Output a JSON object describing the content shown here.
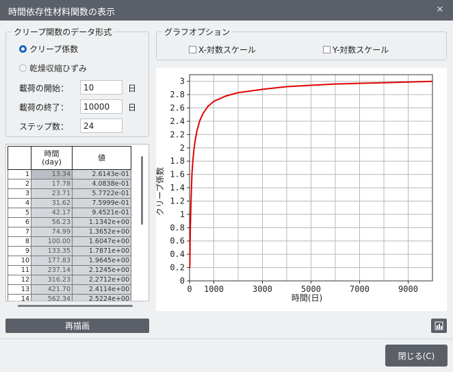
{
  "window": {
    "title": "時間依存性材料関数の表示",
    "close_glyph": "✕"
  },
  "data_format": {
    "group_label": "クリープ関数のデータ形式",
    "options": [
      {
        "label": "クリープ係数",
        "selected": true
      },
      {
        "label": "乾燥収縮ひずみ",
        "selected": false
      }
    ],
    "load_start_label": "載荷の開始：",
    "load_start_value": "10",
    "load_start_unit": "日",
    "load_end_label": "載荷の終了：",
    "load_end_value": "10000",
    "load_end_unit": "日",
    "steps_label": "ステップ数：",
    "steps_value": "24"
  },
  "graph_options": {
    "group_label": "グラフオプション",
    "x_log_label": "X-対数スケール",
    "x_log_checked": false,
    "y_log_label": "Y-対数スケール",
    "y_log_checked": false
  },
  "table": {
    "headers": [
      "",
      "時間\n(day)",
      "値"
    ],
    "rows": [
      [
        "1",
        "13.34",
        "2.6143e-01"
      ],
      [
        "2",
        "17.78",
        "4.0838e-01"
      ],
      [
        "3",
        "23.71",
        "5.7722e-01"
      ],
      [
        "4",
        "31.62",
        "7.5999e-01"
      ],
      [
        "5",
        "42.17",
        "9.4521e-01"
      ],
      [
        "6",
        "56.23",
        "1.1342e+00"
      ],
      [
        "7",
        "74.99",
        "1.3652e+00"
      ],
      [
        "8",
        "100.00",
        "1.6047e+00"
      ],
      [
        "9",
        "133.35",
        "1.7871e+00"
      ],
      [
        "10",
        "177.83",
        "1.9645e+00"
      ],
      [
        "11",
        "237.14",
        "2.1245e+00"
      ],
      [
        "12",
        "316.23",
        "2.2712e+00"
      ],
      [
        "13",
        "421.70",
        "2.4114e+00"
      ],
      [
        "14",
        "562.34",
        "2.5224e+00"
      ]
    ]
  },
  "buttons": {
    "redraw": "再描画",
    "close": "閉じる(C)",
    "chart_icon": "bar-chart-icon"
  },
  "chart_data": {
    "type": "line",
    "xlabel": "時間(日)",
    "ylabel": "クリープ係数",
    "xlim": [
      0,
      10000
    ],
    "ylim": [
      0,
      3.1
    ],
    "xticks": [
      0,
      1000,
      3000,
      5000,
      7000,
      9000
    ],
    "yticks": [
      0,
      0.2,
      0.4,
      0.6,
      0.8,
      1,
      1.2,
      1.4,
      1.6,
      1.8,
      2,
      2.2,
      2.4,
      2.6,
      2.8,
      3
    ],
    "grid": true,
    "line_color": "#e00000",
    "series": [
      {
        "x": [
          10,
          13.34,
          17.78,
          23.71,
          31.62,
          42.17,
          56.23,
          74.99,
          100,
          133.35,
          177.83,
          237.14,
          316.23,
          421.7,
          562.34,
          750,
          1000,
          1500,
          2000,
          3000,
          4000,
          5000,
          6000,
          7000,
          8000,
          9000,
          10000
        ],
        "y": [
          0.2,
          0.26143,
          0.40838,
          0.57722,
          0.75999,
          0.94521,
          1.1342,
          1.3652,
          1.6047,
          1.7871,
          1.9645,
          2.1245,
          2.2712,
          2.4114,
          2.5224,
          2.62,
          2.7,
          2.78,
          2.83,
          2.88,
          2.92,
          2.94,
          2.96,
          2.97,
          2.98,
          2.99,
          3.0
        ]
      }
    ]
  }
}
